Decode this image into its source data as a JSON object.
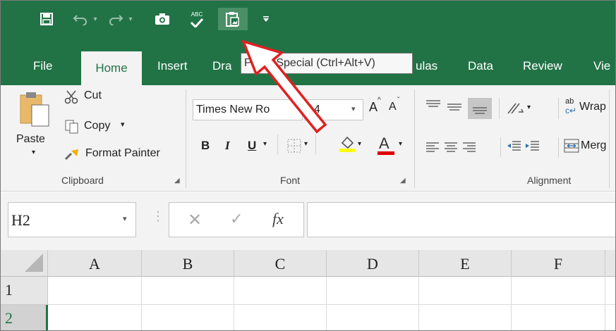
{
  "qat": {
    "icons": [
      "save-icon",
      "undo-icon",
      "redo-icon",
      "camera-icon",
      "spelling-icon",
      "paste-special-icon",
      "customize-icon"
    ]
  },
  "tabs": [
    "File",
    "Home",
    "Insert",
    "Dra",
    "ulas",
    "Data",
    "Review",
    "Vie"
  ],
  "tooltip": "Paste Special (Ctrl+Alt+V)",
  "clipboard": {
    "paste": "Paste",
    "cut": "Cut",
    "copy": "Copy",
    "format_painter": "Format Painter",
    "group": "Clipboard"
  },
  "font": {
    "name": "Times New Ro",
    "size": "14",
    "bold": "B",
    "italic": "I",
    "underline": "U",
    "grow": "A",
    "shrink": "A",
    "color_a": "A",
    "group": "Font"
  },
  "alignment": {
    "wrap": "Wrap",
    "merge": "Merg",
    "ab": "ab",
    "group": "Alignment"
  },
  "formula_bar": {
    "name_box": "H2",
    "fx": "fx"
  },
  "sheet": {
    "columns": [
      "A",
      "B",
      "C",
      "D",
      "E",
      "F"
    ],
    "rows": [
      "1",
      "2"
    ]
  },
  "colors": {
    "brand_green": "#217346",
    "arrow_red": "#e02020"
  }
}
